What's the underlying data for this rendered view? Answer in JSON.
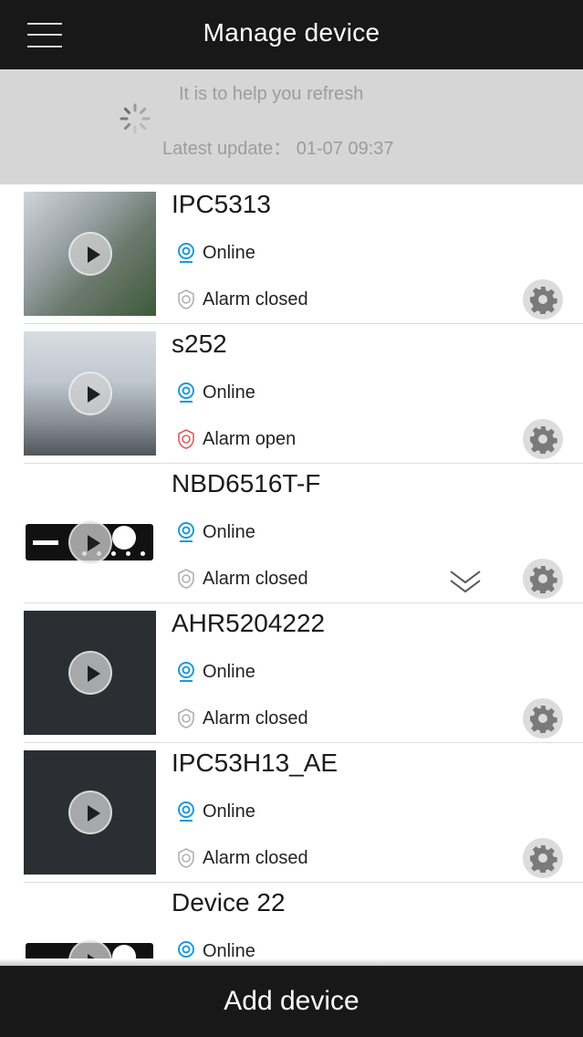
{
  "header": {
    "title": "Manage device"
  },
  "refresh": {
    "message": "It is to help you refresh",
    "last_update": "Latest update： 01-07 09:37"
  },
  "devices": [
    {
      "name": "IPC5313",
      "status": "Online",
      "alarm": "Alarm closed",
      "alarm_state": "closed",
      "thumb": "camera-outdoor"
    },
    {
      "name": "s252",
      "status": "Online",
      "alarm": "Alarm open",
      "alarm_state": "open",
      "thumb": "camera-indoor"
    },
    {
      "name": "NBD6516T-F",
      "status": "Online",
      "alarm": "Alarm closed",
      "alarm_state": "closed",
      "thumb": "nvr"
    },
    {
      "name": "AHR5204222",
      "status": "Online",
      "alarm": "Alarm closed",
      "alarm_state": "closed",
      "thumb": "dark"
    },
    {
      "name": "IPC53H13_AE",
      "status": "Online",
      "alarm": "Alarm closed",
      "alarm_state": "closed",
      "thumb": "dark"
    },
    {
      "name": "Device 22",
      "status": "Online",
      "alarm": "",
      "alarm_state": "closed",
      "thumb": "nvr"
    }
  ],
  "footer": {
    "add_label": "Add device"
  },
  "colors": {
    "bar": "#181818",
    "online": "#1e9ad6",
    "alarm_open": "#e05a5a",
    "alarm_closed": "#b0b0b0"
  }
}
